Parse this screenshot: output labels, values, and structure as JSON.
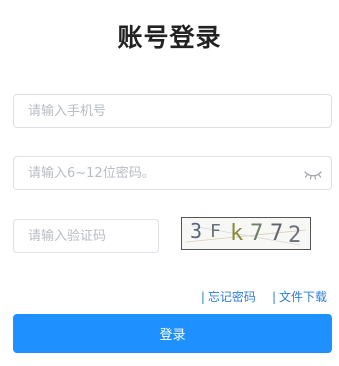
{
  "page": {
    "title": "账号登录"
  },
  "form": {
    "phone_placeholder": "请输入手机号",
    "password_placeholder": "请输入6~12位密码。",
    "captcha_placeholder": "请输入验证码",
    "captcha_text": [
      "3",
      "F",
      "k",
      "7",
      "7",
      "2"
    ]
  },
  "links": {
    "separator": "|",
    "forgot_password": "忘记密码",
    "file_download": "文件下载"
  },
  "actions": {
    "login_label": "登录"
  },
  "colors": {
    "primary": "#1e90ff",
    "link": "#2d7fd8",
    "border": "#dcdfe6",
    "placeholder": "#b8bcc4"
  },
  "icons": {
    "password_toggle": "eye-closed-icon"
  }
}
